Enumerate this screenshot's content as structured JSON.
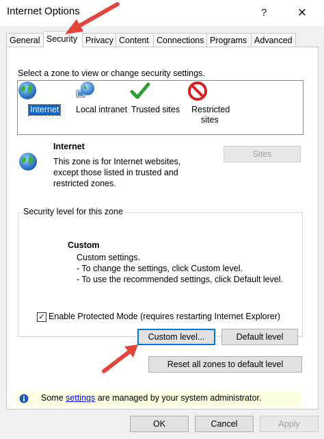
{
  "window": {
    "title": "Internet Options",
    "help_glyph": "?",
    "close_glyph": "✕"
  },
  "tabs": [
    {
      "label": "General"
    },
    {
      "label": "Security"
    },
    {
      "label": "Privacy"
    },
    {
      "label": "Content"
    },
    {
      "label": "Connections"
    },
    {
      "label": "Programs"
    },
    {
      "label": "Advanced"
    }
  ],
  "security": {
    "zone_prompt": "Select a zone to view or change security settings.",
    "zones": [
      {
        "label": "Internet",
        "icon": "globe-icon"
      },
      {
        "label": "Local intranet",
        "icon": "intranet-icon"
      },
      {
        "label": "Trusted sites",
        "icon": "checkmark-icon"
      },
      {
        "label_line1": "Restricted",
        "label_line2": "sites",
        "icon": "restricted-icon"
      }
    ],
    "zone_info": {
      "name": "Internet",
      "desc_line1": "This zone is for Internet websites,",
      "desc_line2": "except those listed in trusted and",
      "desc_line3": "restricted zones."
    },
    "sites_button": "Sites",
    "level_group_title": "Security level for this zone",
    "level": {
      "name": "Custom",
      "line1": "Custom settings.",
      "line2": "- To change the settings, click Custom level.",
      "line3": "- To use the recommended settings, click Default level."
    },
    "protected_mode_label": "Enable Protected Mode (requires restarting Internet Explorer)",
    "protected_mode_checked": "✓",
    "custom_level_button": "Custom level...",
    "default_level_button": "Default level",
    "reset_button": "Reset all zones to default level",
    "info_prefix": "Some ",
    "info_link": "settings",
    "info_suffix": " are managed by your system administrator."
  },
  "footer": {
    "ok": "OK",
    "cancel": "Cancel",
    "apply": "Apply"
  },
  "colors": {
    "selection": "#0a64c8",
    "annotation_arrow": "#e2453c",
    "info_bar": "#ffffe1",
    "focus_border": "#0078d7"
  }
}
